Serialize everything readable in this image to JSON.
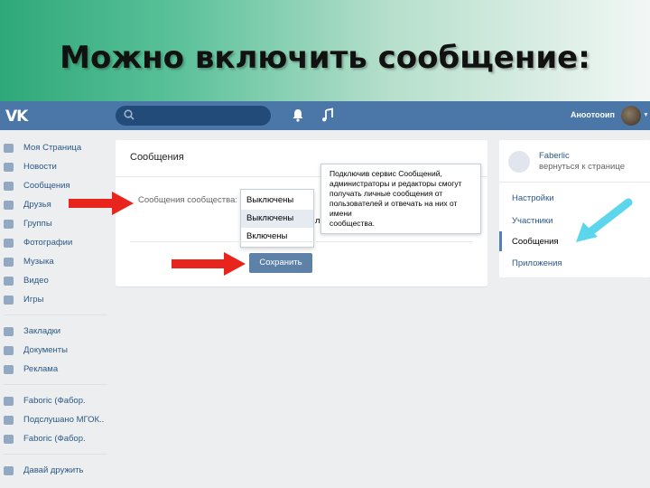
{
  "slide": {
    "title": "Можно включить сообщение:"
  },
  "topbar": {
    "logo": "VK",
    "user_name": "Аноотооип"
  },
  "left_menu": [
    {
      "label": "Моя Страница",
      "icon": "home-icon"
    },
    {
      "label": "Новости",
      "icon": "news-icon"
    },
    {
      "label": "Сообщения",
      "icon": "messages-icon"
    },
    {
      "label": "Друзья",
      "icon": "friends-icon"
    },
    {
      "label": "Группы",
      "icon": "groups-icon"
    },
    {
      "label": "Фотографии",
      "icon": "photo-icon"
    },
    {
      "label": "Музыка",
      "icon": "music-icon"
    },
    {
      "label": "Видео",
      "icon": "video-icon"
    },
    {
      "label": "Игры",
      "icon": "games-icon"
    },
    {
      "label": "Закладки",
      "icon": "bookmark-icon"
    },
    {
      "label": "Документы",
      "icon": "document-icon"
    },
    {
      "label": "Реклама",
      "icon": "ads-icon"
    },
    {
      "label": "Faboric (Фабор.",
      "icon": "community-icon"
    },
    {
      "label": "Подслушано МГОК..",
      "icon": "community-icon"
    },
    {
      "label": "Faboric (Фабор.",
      "icon": "community-icon"
    },
    {
      "label": "Давай дружить",
      "icon": "apps-icon"
    }
  ],
  "main": {
    "title": "Сообщения",
    "field_label": "Сообщения сообщества:",
    "dropdown_options": [
      "Выключены",
      "Выключены",
      "Включены"
    ],
    "behind_text": "ль",
    "save_label": "Сохранить",
    "tooltip_lines": [
      "Подключив сервис Сообщений,",
      "администраторы и редакторы смогут",
      "получать личные сообщения от",
      "пользователей и отвечать на них от имени",
      "сообщества."
    ]
  },
  "right_panel": {
    "name": "Faberlic",
    "sub": "вернуться к странице",
    "items": [
      "Настройки",
      "Участники",
      "Сообщения",
      "Приложения"
    ],
    "active_item": "Сообщения"
  },
  "colors": {
    "vk_blue": "#4a76a8",
    "button": "#5e81a8",
    "red_arrow": "#e8241c",
    "cyan_arrow": "#5cd6ec"
  }
}
